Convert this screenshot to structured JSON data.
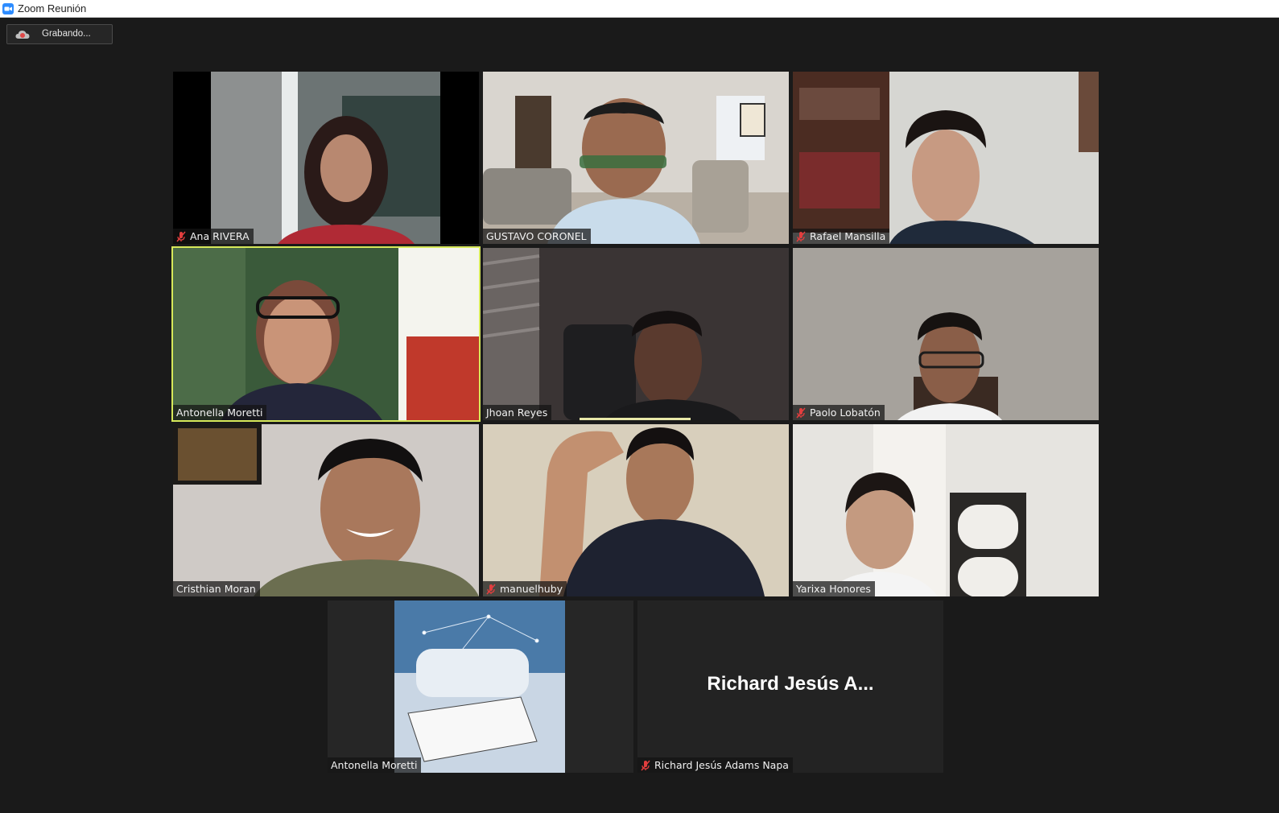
{
  "window": {
    "title": "Zoom Reunión",
    "app_icon": "zoom-camera-icon",
    "accent": "#2d8cff"
  },
  "recording": {
    "label": "Grabando...",
    "icon": "cloud-record-icon",
    "icon_color": "#e04848"
  },
  "participants": [
    {
      "name": "Ana RIVERA",
      "muted": true
    },
    {
      "name": "GUSTAVO CORONEL",
      "muted": false
    },
    {
      "name": "Rafael Mansilla",
      "muted": true
    },
    {
      "name": "Antonella Moretti",
      "muted": false,
      "active_speaker": true
    },
    {
      "name": "Jhoan Reyes",
      "muted": false
    },
    {
      "name": "Paolo Lobatón",
      "muted": true
    },
    {
      "name": "Cristhian Moran",
      "muted": false
    },
    {
      "name": "manuelhuby",
      "muted": true
    },
    {
      "name": "Yarixa Honores",
      "muted": false
    },
    {
      "name": "Antonella Moretti",
      "muted": false,
      "screen_image": true
    },
    {
      "name": "Richard Jesús Adams Napa",
      "muted": true,
      "video_off": true,
      "display_name": "Richard Jesús A..."
    }
  ],
  "colors": {
    "background": "#1a1a1a",
    "active_speaker_border": "#d6e85a",
    "muted_icon": "#e23e3e"
  }
}
